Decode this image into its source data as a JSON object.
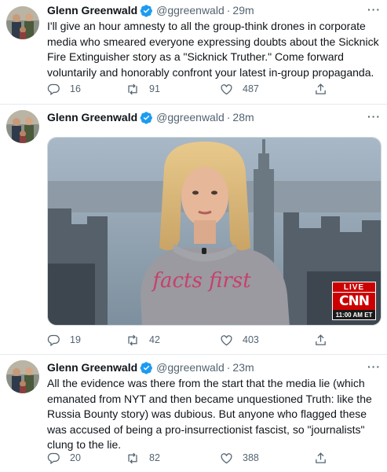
{
  "tweets": [
    {
      "author_name": "Glenn Greenwald",
      "handle": "@ggreenwald",
      "separator": "·",
      "time": "29m",
      "text": "I'll give an hour amnesty to all the group-think drones in corporate media who smeared everyone expressing doubts about the Sicknick Fire Extinguisher story as a \"Sicknick Truther.\" Come forward voluntarily and honorably confront your latest in-group propaganda.",
      "replies": "16",
      "retweets": "91",
      "likes": "487"
    },
    {
      "author_name": "Glenn Greenwald",
      "handle": "@ggreenwald",
      "separator": "·",
      "time": "28m",
      "media": {
        "shirt_text": "facts first",
        "live_label": "LIVE",
        "network_logo": "CNN",
        "broadcast_time": "11:00 AM ET"
      },
      "replies": "19",
      "retweets": "42",
      "likes": "403"
    },
    {
      "author_name": "Glenn Greenwald",
      "handle": "@ggreenwald",
      "separator": "·",
      "time": "23m",
      "text": "All the evidence was there from the start that the media lie (which emanated from NYT and then became unquestioned Truth: like the Russia Bounty story) was dubious. But anyone who flagged these was accused of being a pro-insurrectionist fascist, so \"journalists\" clung to the lie.",
      "replies": "20",
      "retweets": "82",
      "likes": "388"
    }
  ],
  "colors": {
    "verified_blue": "#1d9bf0",
    "secondary_text": "#536471",
    "cnn_red": "#cc0000"
  },
  "icons": [
    "verified-badge-icon",
    "more-icon",
    "reply-icon",
    "retweet-icon",
    "like-icon",
    "share-icon"
  ]
}
